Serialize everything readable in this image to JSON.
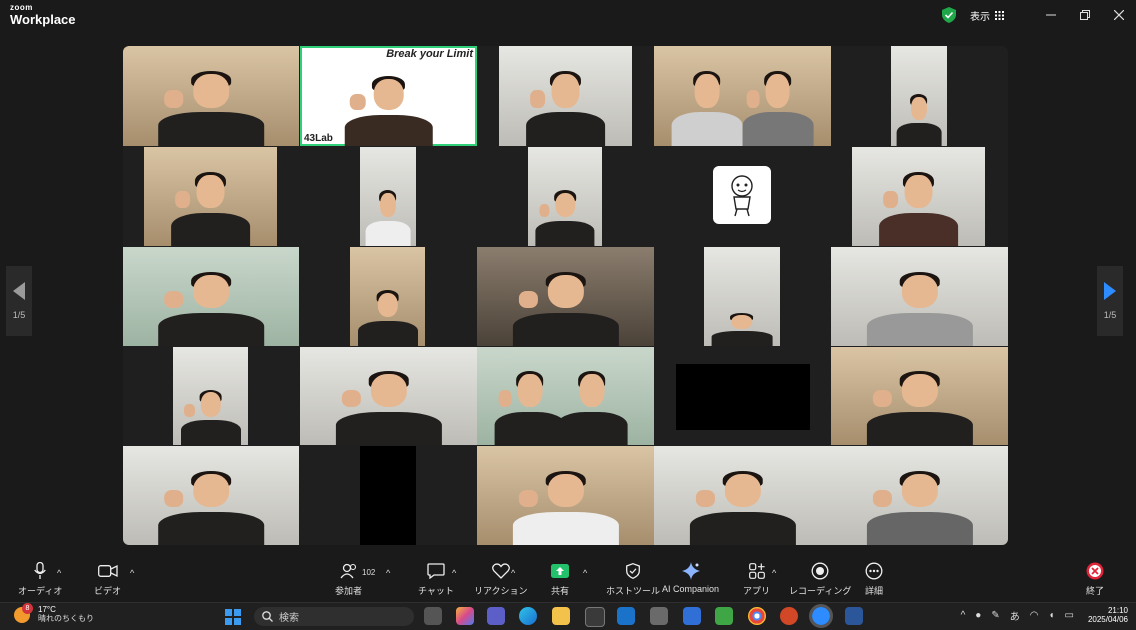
{
  "app": {
    "brand_small": "zoom",
    "brand_big": "Workplace"
  },
  "titlebar": {
    "view_label": "表示"
  },
  "gallery": {
    "host_overlay": "Break your Limit",
    "brand_mark": "43Lab",
    "page_left": "1/5",
    "page_right": "1/5"
  },
  "toolbar": {
    "audio": "オーディオ",
    "video": "ビデオ",
    "participants": "参加者",
    "participants_count": "102",
    "chat": "チャット",
    "reactions": "リアクション",
    "share": "共有",
    "host_tools": "ホストツール",
    "ai_companion": "AI Companion",
    "apps": "アプリ",
    "recording": "レコーディング",
    "more": "詳細",
    "end": "終了"
  },
  "taskbar": {
    "weather_badge": "8",
    "temperature": "17°C",
    "weather_desc": "晴れのちくもり",
    "search_placeholder": "検索",
    "ime": "あ",
    "time": "21:10",
    "date": "2025/04/06"
  },
  "colors": {
    "accent_green": "#2fd07a",
    "share_green": "#23c16b",
    "end_red": "#e0243a",
    "background": "#1a1a1a"
  }
}
